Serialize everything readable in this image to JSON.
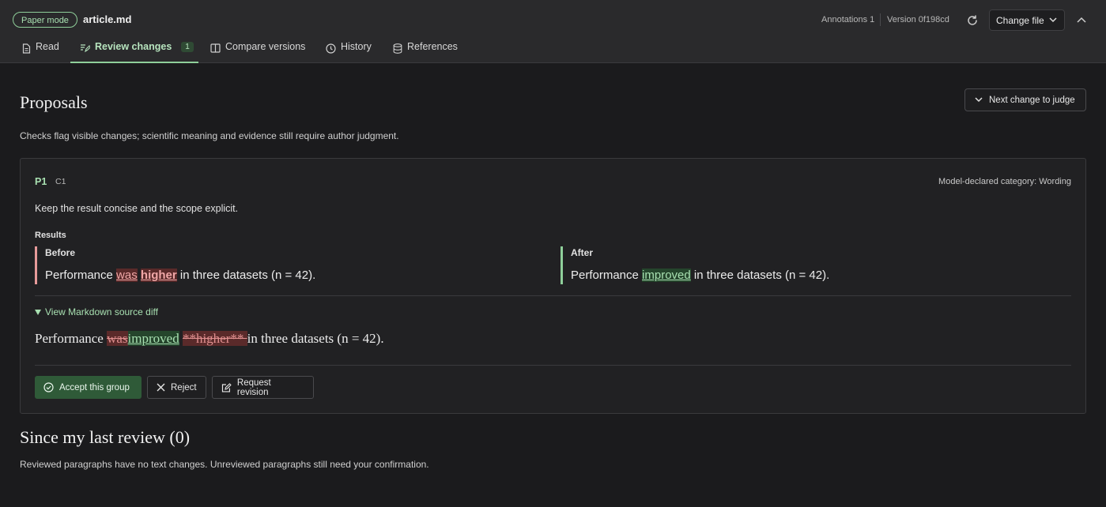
{
  "header": {
    "mode_badge": "Paper mode",
    "filename": "article.md",
    "annotations": "Annotations 1",
    "version": "Version 0f198cd",
    "change_file": "Change file"
  },
  "tabs": [
    {
      "label": "Read",
      "icon": "document-icon"
    },
    {
      "label": "Review changes",
      "icon": "edit-icon",
      "count": "1"
    },
    {
      "label": "Compare versions",
      "icon": "columns-icon"
    },
    {
      "label": "History",
      "icon": "clock-icon"
    },
    {
      "label": "References",
      "icon": "database-icon"
    }
  ],
  "proposals": {
    "title": "Proposals",
    "next_change": "Next change to judge",
    "description": "Checks flag visible changes; scientific meaning and evidence still require author judgment.",
    "card": {
      "id": "P1",
      "group": "C1",
      "category": "Model-declared category: Wording",
      "summary": "Keep the result concise and the scope explicit.",
      "results_label": "Results",
      "before_label": "Before",
      "after_label": "After",
      "before": {
        "pre": "Performance ",
        "del1": "was",
        "mid": " ",
        "del2": "higher",
        "post": " in three datasets (n = 42)."
      },
      "after": {
        "pre": "Performance ",
        "ins": "improved",
        "post": " in three datasets (n = 42)."
      },
      "source_toggle": "View Markdown source diff",
      "source": {
        "pre": "Performance ",
        "del1": "was",
        "ins": "improved",
        "mid": " ",
        "del2": "**higher** ",
        "post": "in three datasets (n = 42)."
      },
      "actions": {
        "accept": "Accept this group",
        "reject": "Reject",
        "revise": "Request revision"
      }
    }
  },
  "since_review": {
    "title": "Since my last review (0)",
    "description": "Reviewed paragraphs have no text changes. Unreviewed paragraphs still need your confirmation."
  },
  "colors": {
    "accent": "#8fcf9a",
    "deletion": "#f0a7a7",
    "insertion": "#a8e0b1",
    "accept_bg": "#2f5a38"
  }
}
